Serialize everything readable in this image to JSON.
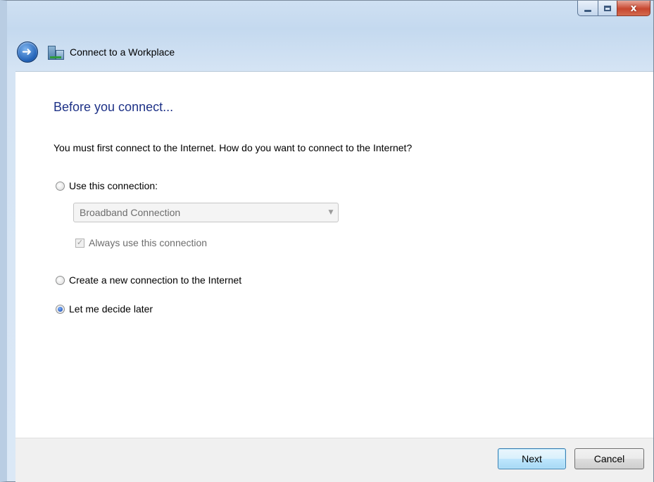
{
  "window": {
    "caption_buttons": {
      "minimize_icon": "minimize-icon",
      "maximize_icon": "maximize-icon",
      "close_glyph": "x"
    }
  },
  "header": {
    "back_icon": "back-arrow-icon",
    "wizard_icon": "connect-to-workplace-icon",
    "title": "Connect to a Workplace"
  },
  "main": {
    "heading": "Before you connect...",
    "question": "You must first connect to the Internet. How do you want to connect to the Internet?",
    "options": [
      {
        "label": "Use this connection:",
        "checked": false
      },
      {
        "label": "Create a new connection to the Internet",
        "checked": false
      },
      {
        "label": "Let me decide later",
        "checked": true
      }
    ],
    "connection_dropdown": {
      "selected": "Broadband Connection",
      "enabled": false
    },
    "always_use_checkbox": {
      "label": "Always use this connection",
      "checked": true,
      "enabled": false
    }
  },
  "footer": {
    "next_label": "Next",
    "cancel_label": "Cancel"
  },
  "colors": {
    "heading": "#1e3287",
    "frame": "#c4d9ef",
    "disabled_text": "#6d6d6d"
  }
}
